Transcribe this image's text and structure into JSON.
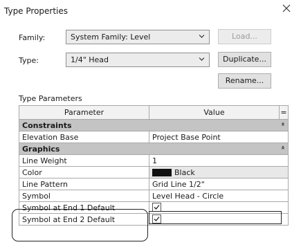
{
  "window": {
    "title": "Type Properties"
  },
  "family": {
    "label": "Family:",
    "value": "System Family: Level"
  },
  "type": {
    "label": "Type:",
    "value": "1/4\" Head"
  },
  "buttons": {
    "load": "Load...",
    "duplicate": "Duplicate...",
    "rename": "Rename..."
  },
  "section_label": "Type Parameters",
  "grid": {
    "col_parameter": "Parameter",
    "col_value": "Value",
    "col_extra": "=",
    "group_constraints": "Constraints",
    "group_graphics": "Graphics",
    "collapse_glyph": "»",
    "rows": {
      "elevation_base": {
        "param": "Elevation Base",
        "value": "Project Base Point"
      },
      "line_weight": {
        "param": "Line Weight",
        "value": "1"
      },
      "color": {
        "param": "Color",
        "value": "Black",
        "swatch": "#111111"
      },
      "line_pattern": {
        "param": "Line Pattern",
        "value": "Grid Line 1/2\""
      },
      "symbol": {
        "param": "Symbol",
        "value": "Level Head - Circle"
      },
      "end1": {
        "param": "Symbol at End 1 Default",
        "checked": true
      },
      "end2": {
        "param": "Symbol at End 2 Default",
        "checked": true
      }
    }
  }
}
